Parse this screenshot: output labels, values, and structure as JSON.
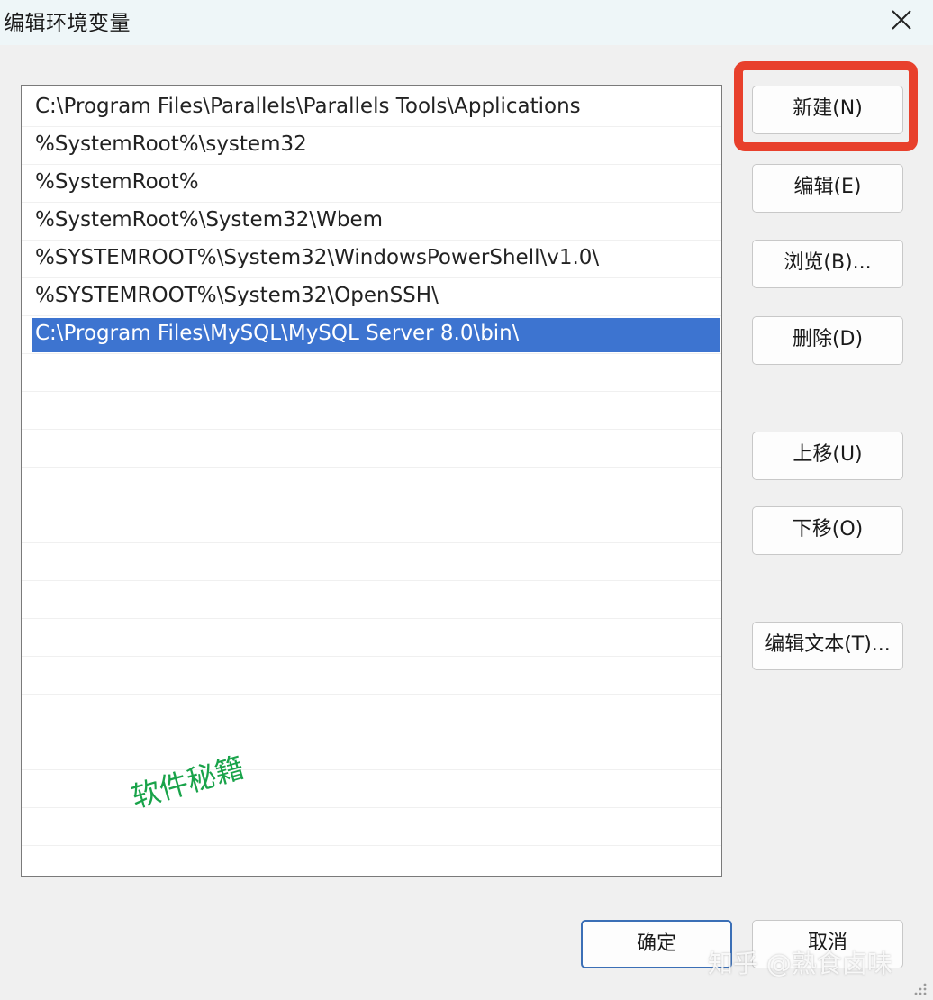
{
  "window": {
    "title": "编辑环境变量"
  },
  "paths": [
    {
      "value": "C:\\Program Files\\Parallels\\Parallels Tools\\Applications",
      "selected": false
    },
    {
      "value": "%SystemRoot%\\system32",
      "selected": false
    },
    {
      "value": "%SystemRoot%",
      "selected": false
    },
    {
      "value": "%SystemRoot%\\System32\\Wbem",
      "selected": false
    },
    {
      "value": "%SYSTEMROOT%\\System32\\WindowsPowerShell\\v1.0\\",
      "selected": false
    },
    {
      "value": "%SYSTEMROOT%\\System32\\OpenSSH\\",
      "selected": false
    },
    {
      "value": "C:\\Program Files\\MySQL\\MySQL Server 8.0\\bin\\",
      "selected": true
    }
  ],
  "buttons": {
    "new": "新建(N)",
    "edit": "编辑(E)",
    "browse": "浏览(B)...",
    "delete": "删除(D)",
    "move_up": "上移(U)",
    "move_down": "下移(O)",
    "edit_text": "编辑文本(T)...",
    "ok": "确定",
    "cancel": "取消"
  },
  "watermarks": {
    "overlay_text": "软件秘籍",
    "source_text": "知乎 @熟食卤味"
  },
  "colors": {
    "selection": "#3d74d0",
    "highlight_box": "#e8402c",
    "overlay_text": "#19a34a"
  }
}
